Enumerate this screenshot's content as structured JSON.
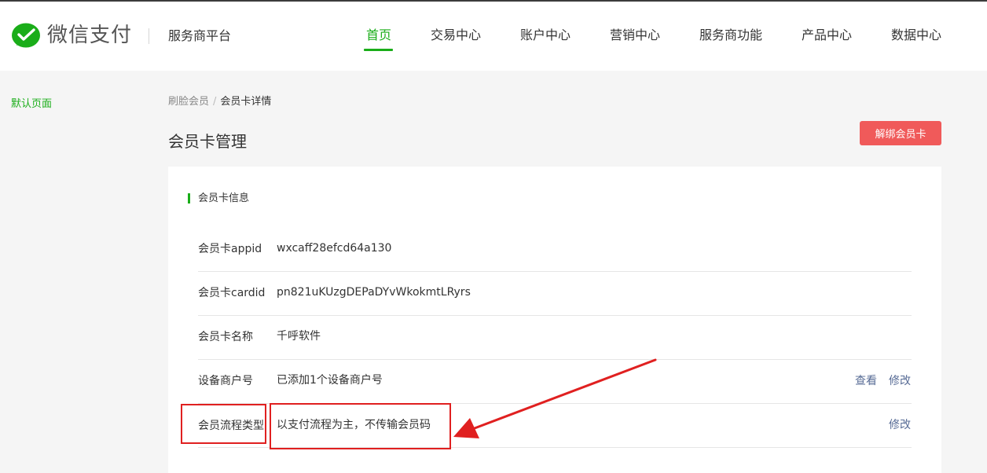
{
  "header": {
    "logo_text": "微信支付",
    "platform": "服务商平台",
    "nav": [
      {
        "label": "首页",
        "active": true
      },
      {
        "label": "交易中心"
      },
      {
        "label": "账户中心"
      },
      {
        "label": "营销中心"
      },
      {
        "label": "服务商功能"
      },
      {
        "label": "产品中心"
      },
      {
        "label": "数据中心"
      }
    ]
  },
  "sidebar": {
    "items": [
      {
        "label": "默认页面",
        "active": true
      }
    ]
  },
  "breadcrumb": {
    "parent": "刷脸会员",
    "separator": "/",
    "current": "会员卡详情"
  },
  "page": {
    "title": "会员卡管理",
    "unbind_label": "解绑会员卡"
  },
  "card": {
    "section_title": "会员卡信息",
    "rows": [
      {
        "label": "会员卡appid",
        "value": "wxcaff28efcd64a130"
      },
      {
        "label": "会员卡cardid",
        "value": "pn821uKUzgDEPaDYvWkokmtLRyrs"
      },
      {
        "label": "会员卡名称",
        "value": "千呼软件"
      },
      {
        "label": "设备商户号",
        "value": "已添加1个设备商户号",
        "actions": [
          "查看",
          "修改"
        ]
      },
      {
        "label": "会员流程类型",
        "value": "以支付流程为主，不传输会员码",
        "actions": [
          "修改"
        ]
      }
    ]
  },
  "colors": {
    "brand_green": "#1aad19",
    "danger_red": "#f05a5a",
    "link_blue": "#576b95",
    "annotation_red": "#e02020"
  }
}
